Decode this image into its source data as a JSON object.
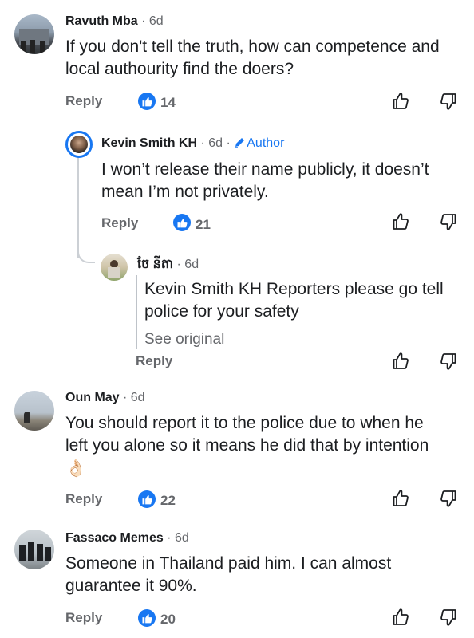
{
  "comments": [
    {
      "name": "Ravuth Mba",
      "time": " · 6d",
      "line1": "If you don't tell the truth, how can competence and",
      "line2": "local authourity find the doers?",
      "reply": "Reply",
      "likes": "14"
    },
    {
      "name": "Kevin Smith KH",
      "time": " · 6d · ",
      "author_label": "Author",
      "line1": "I won’t release their name publicly, it doesn’t",
      "line2": "mean I’m not privately.",
      "reply": "Reply",
      "likes": "21"
    },
    {
      "name": "ចែ នីតា",
      "time": " · 6d",
      "line1": "Kevin Smith KH Reporters please go tell",
      "line2": "police for your safety",
      "see_original": "See original",
      "reply": "Reply"
    },
    {
      "name": "Oun May",
      "time": " · 6d",
      "line1": "You should report it to the police due to when he",
      "line2": "left you alone so it means he did that by intention",
      "emoji": "👌🏻",
      "reply": "Reply",
      "likes": "22"
    },
    {
      "name": "Fassaco Memes",
      "time": " · 6d",
      "line1": "Someone in Thailand paid him.  I can almost",
      "line2": "guarantee it 90%.",
      "reply": "Reply",
      "likes": "20"
    }
  ],
  "colors": {
    "like_blue": "#1877f2",
    "meta_gray": "#65676b",
    "thread_line": "#ccd0d5"
  },
  "icons": [
    "like-badge-icon",
    "thumbs-up-icon",
    "thumbs-down-icon",
    "pencil-icon"
  ]
}
